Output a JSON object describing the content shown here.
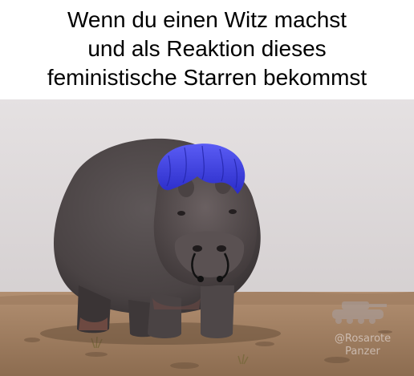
{
  "caption": {
    "line1": "Wenn du einen Witz machst",
    "line2": "und als Reaktion dieses",
    "line3": "feministische Starren bekommst"
  },
  "image": {
    "subject": "hippopotamus-with-blue-hair-and-septum-piercing"
  },
  "watermark": {
    "line1": "@Rosarote",
    "line2": "Panzer"
  },
  "colors": {
    "sky_top": "#e3dfe0",
    "sky_bottom": "#d7d3d4",
    "ground": "#a07d5e",
    "hippo_body": "#4f4849",
    "hippo_dark": "#2e2a2b",
    "hair": "#3d3fe0",
    "piercing": "#111111"
  }
}
